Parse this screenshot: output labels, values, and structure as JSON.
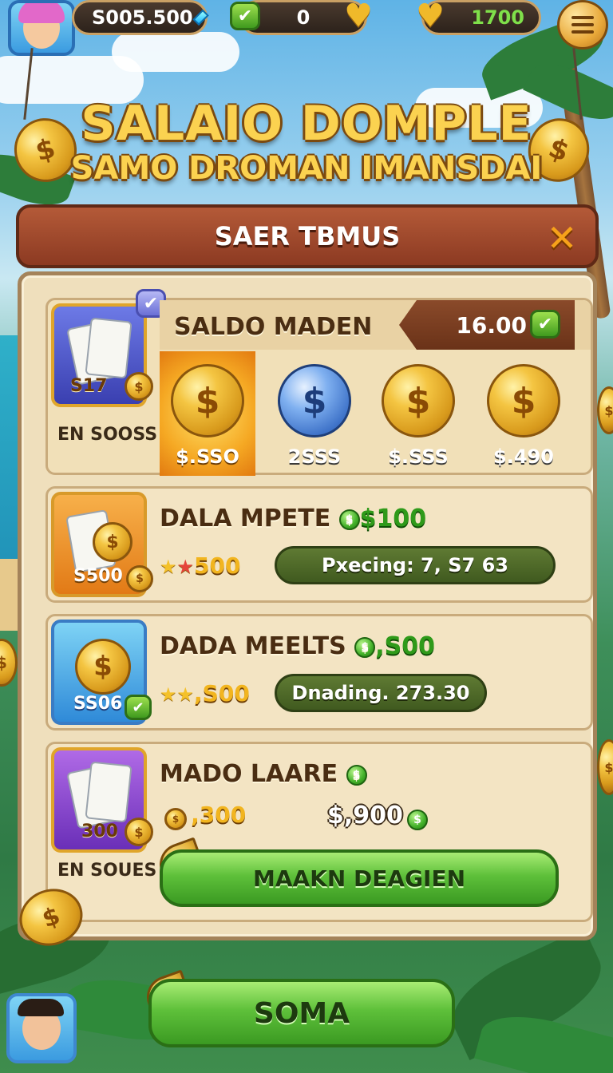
{
  "hud": {
    "balance": "S005.500",
    "hearts_count": "0",
    "gold_count": "1700"
  },
  "title": {
    "line1": "SALAIO DOMPLE",
    "line2": "SAMO DROMAN IMANSDAI"
  },
  "banner": {
    "label": "SAER TBMUS"
  },
  "top_offer": {
    "thumb_label": "S17",
    "subcaption": "EN SOOSS",
    "heading": "SALDO MADEN",
    "amount": "16.00",
    "coin_options": [
      {
        "label": "$.SSO",
        "color": "gold",
        "selected": true
      },
      {
        "label": "2SSS",
        "color": "blue",
        "selected": false
      },
      {
        "label": "$.SSS",
        "color": "gold",
        "selected": false
      },
      {
        "label": "$.490",
        "color": "gold",
        "selected": false
      }
    ]
  },
  "rows": [
    {
      "title": "DALA MPETE",
      "reward": "$100",
      "stars_value": "500",
      "thumb_label": "S500",
      "progress_text": "Pxecing: 7, S7 63"
    },
    {
      "title": "DADA MEELTS",
      "reward": ",S00",
      "stars_value": ",S00",
      "thumb_label": "SS06",
      "progress_text": "Dnading. 273.30"
    },
    {
      "title": "MADO LAARE",
      "coins_value": ",300",
      "price": "$,900",
      "thumb_label": "300",
      "subcaption": "EN SOUES",
      "button_label": "MAAKN DEAGIEN"
    }
  ],
  "bottom": {
    "button_label": "SOMA"
  },
  "colors": {
    "accent_gold": "#fbd250",
    "banner_red": "#9c4428",
    "panel_bg": "#efdfbc",
    "button_green": "#5ec03a"
  }
}
